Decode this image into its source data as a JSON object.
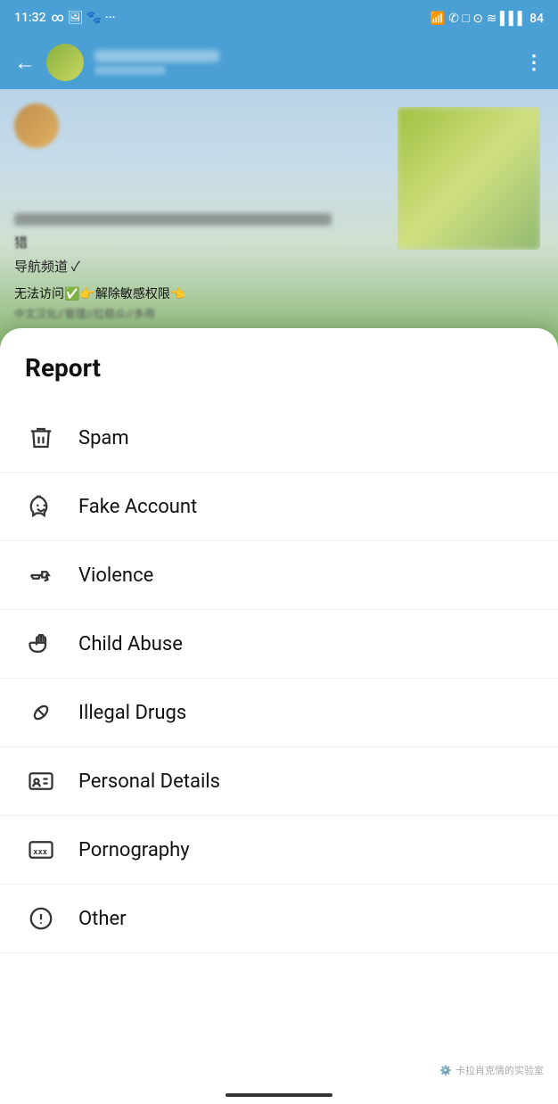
{
  "statusBar": {
    "time": "11:32",
    "icons": [
      "infinity",
      "message",
      "image",
      "paw",
      "more"
    ]
  },
  "navBar": {
    "backLabel": "←",
    "moreLabel": "⋮"
  },
  "reportSheet": {
    "title": "Report",
    "items": [
      {
        "id": "spam",
        "label": "Spam",
        "icon": "trash"
      },
      {
        "id": "fake-account",
        "label": "Fake Account",
        "icon": "mask"
      },
      {
        "id": "violence",
        "label": "Violence",
        "icon": "gun"
      },
      {
        "id": "child-abuse",
        "label": "Child Abuse",
        "icon": "hand"
      },
      {
        "id": "illegal-drugs",
        "label": "Illegal Drugs",
        "icon": "pill"
      },
      {
        "id": "personal-details",
        "label": "Personal Details",
        "icon": "id-card"
      },
      {
        "id": "pornography",
        "label": "Pornography",
        "icon": "xxx"
      },
      {
        "id": "other",
        "label": "Other",
        "icon": "exclamation"
      }
    ]
  },
  "watermark": {
    "text": "卡拉肖克情的实验室"
  }
}
